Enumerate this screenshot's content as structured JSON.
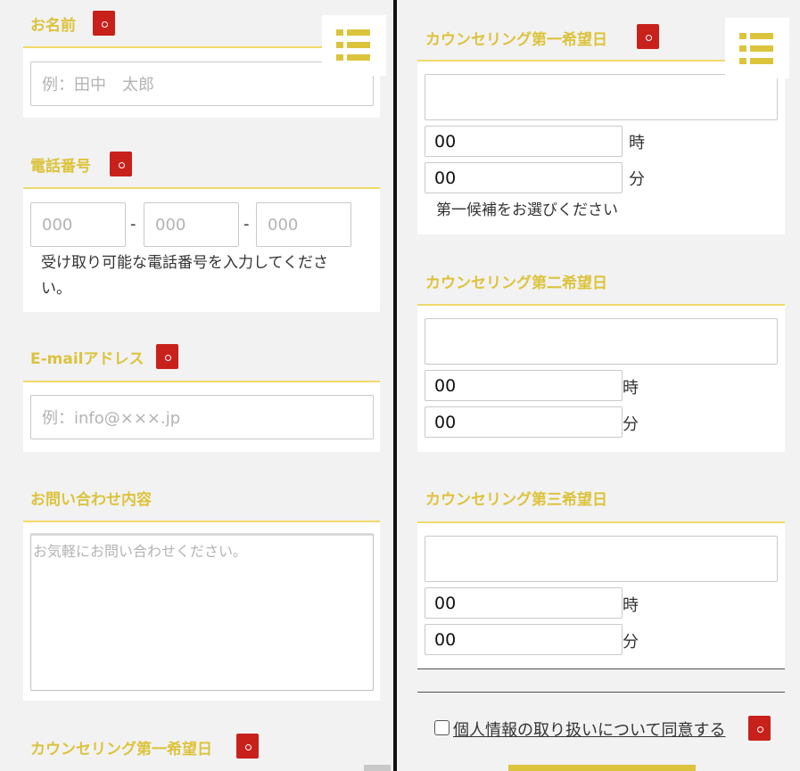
{
  "left": {
    "name": {
      "label": "お名前",
      "placeholder": "例：田中　太郎"
    },
    "phone": {
      "label": "電話番号",
      "placeholders": [
        "000",
        "000",
        "000"
      ],
      "separator": "-",
      "help": "受け取り可能な電話番号を入力してください。"
    },
    "email": {
      "label": "E-mailアドレス",
      "placeholder": "例：info@×××.jp"
    },
    "inquiry": {
      "label": "お問い合わせ内容",
      "placeholder": "お気軽にお問い合わせください。"
    },
    "counseling_first_label": "カウンセリング第一希望日"
  },
  "right": {
    "first": {
      "label": "カウンセリング第一希望日",
      "hour": "00",
      "minute": "00",
      "hour_unit": "時",
      "minute_unit": "分",
      "help": "第一候補をお選びください"
    },
    "second": {
      "label": "カウンセリング第二希望日",
      "hour": "00",
      "minute": "00",
      "hour_unit": "時",
      "minute_unit": "分"
    },
    "third": {
      "label": "カウンセリング第三希望日",
      "hour": "00",
      "minute": "00",
      "hour_unit": "時",
      "minute_unit": "分"
    },
    "consent": "個人情報の取り扱いについて同意する"
  },
  "icons": {
    "menu": "list-menu-icon",
    "required": "required-mark-icon"
  },
  "colors": {
    "accent": "#dcc33c",
    "required": "#c8211c",
    "background": "#f2f2f2",
    "field_border": "#c9c9c9"
  }
}
